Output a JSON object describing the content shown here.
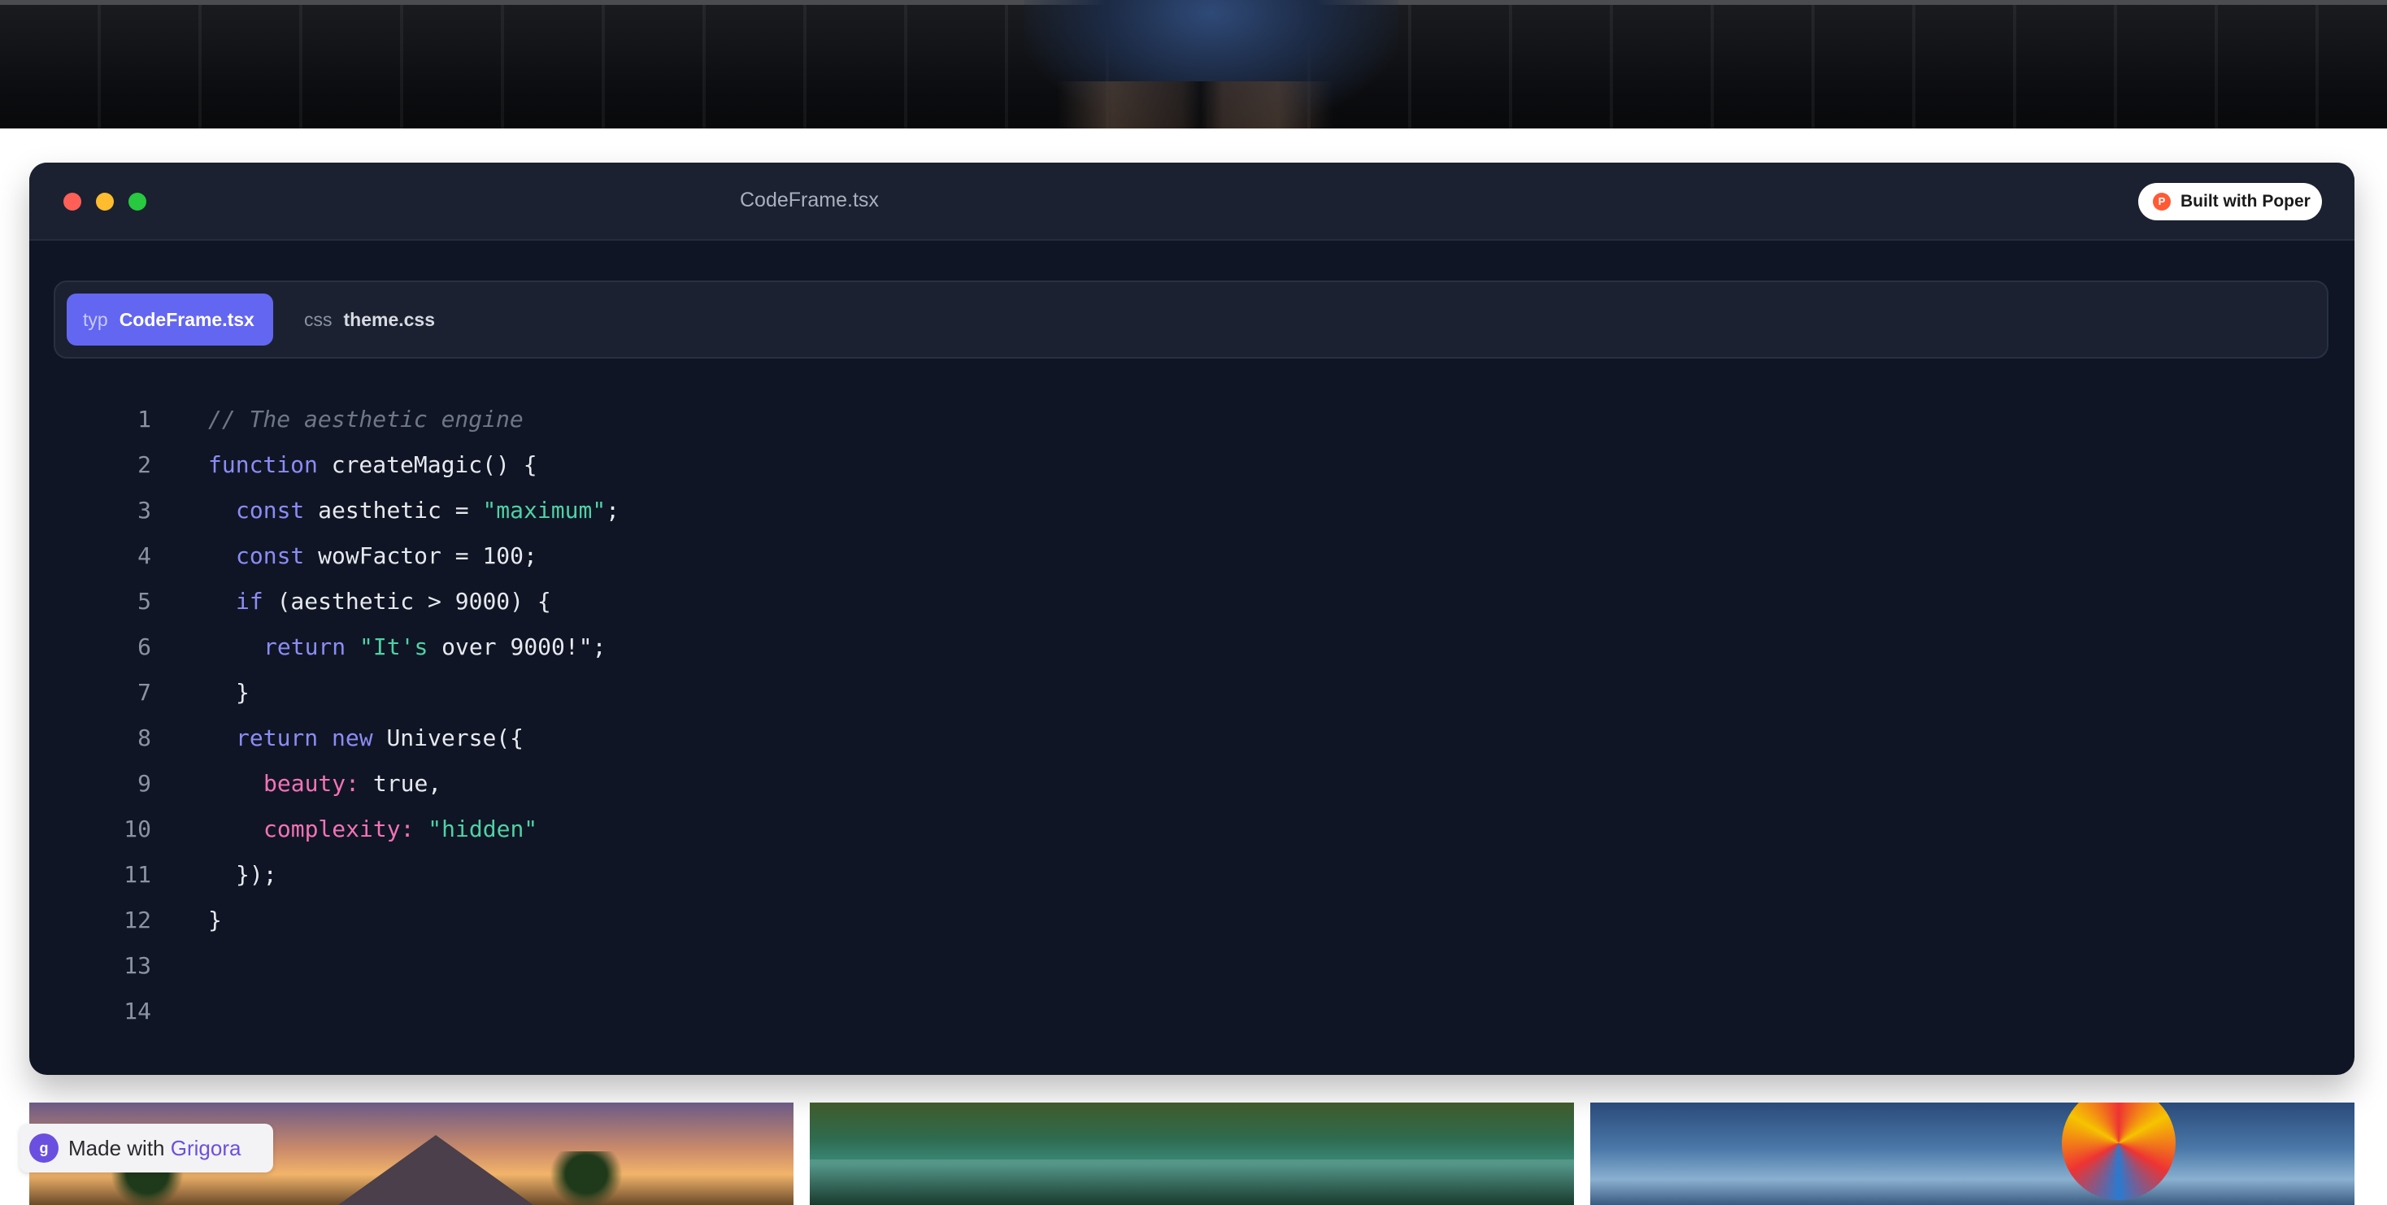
{
  "window": {
    "title": "CodeFrame.tsx",
    "badge_label": "Built with Poper",
    "badge_icon": "poper-logo-icon"
  },
  "tabs": [
    {
      "ext": "typ",
      "name": "CodeFrame.tsx",
      "active": true
    },
    {
      "ext": "css",
      "name": "theme.css",
      "active": false
    }
  ],
  "code_lines": [
    {
      "n": "1",
      "tokens": [
        {
          "t": "// The aesthetic engine",
          "k": "comment"
        }
      ],
      "indent": 0
    },
    {
      "n": "2",
      "tokens": [
        {
          "t": "function",
          "k": "kw"
        },
        {
          "t": " createMagic() {",
          "k": "plain"
        }
      ],
      "indent": 0
    },
    {
      "n": "3",
      "tokens": [
        {
          "t": "const",
          "k": "kw"
        },
        {
          "t": " aesthetic = ",
          "k": "plain"
        },
        {
          "t": "\"maximum\"",
          "k": "str"
        },
        {
          "t": ";",
          "k": "plain"
        }
      ],
      "indent": 1
    },
    {
      "n": "4",
      "tokens": [
        {
          "t": "const",
          "k": "kw"
        },
        {
          "t": " wowFactor = 100;",
          "k": "plain"
        }
      ],
      "indent": 1
    },
    {
      "n": "5",
      "tokens": [
        {
          "t": "if",
          "k": "kw"
        },
        {
          "t": " (aesthetic > 9000) {",
          "k": "plain"
        }
      ],
      "indent": 1
    },
    {
      "n": "6",
      "tokens": [
        {
          "t": "return",
          "k": "kw"
        },
        {
          "t": " ",
          "k": "plain"
        },
        {
          "t": "\"It's",
          "k": "str"
        },
        {
          "t": " over 9000!\";",
          "k": "plain"
        }
      ],
      "indent": 2
    },
    {
      "n": "7",
      "tokens": [
        {
          "t": "}",
          "k": "plain"
        }
      ],
      "indent": 1
    },
    {
      "n": "8",
      "tokens": [
        {
          "t": "return",
          "k": "kw"
        },
        {
          "t": " ",
          "k": "plain"
        },
        {
          "t": "new",
          "k": "kw"
        },
        {
          "t": " Universe({",
          "k": "plain"
        }
      ],
      "indent": 1
    },
    {
      "n": "9",
      "tokens": [
        {
          "t": "beauty:",
          "k": "prop"
        },
        {
          "t": " true,",
          "k": "plain"
        }
      ],
      "indent": 2
    },
    {
      "n": "10",
      "tokens": [
        {
          "t": "complexity:",
          "k": "prop"
        },
        {
          "t": " ",
          "k": "plain"
        },
        {
          "t": "\"hidden\"",
          "k": "str"
        }
      ],
      "indent": 2
    },
    {
      "n": "11",
      "tokens": [
        {
          "t": "});",
          "k": "plain"
        }
      ],
      "indent": 1
    },
    {
      "n": "12",
      "tokens": [
        {
          "t": "}",
          "k": "plain"
        }
      ],
      "indent": 0
    },
    {
      "n": "13",
      "tokens": [],
      "indent": 0
    },
    {
      "n": "14",
      "tokens": [],
      "indent": 0
    }
  ],
  "footer": {
    "made_with": "Made with",
    "brand": "Grigora",
    "icon": "grigora-logo-icon",
    "icon_glyph": "g"
  },
  "badge_glyph": "P",
  "colors": {
    "accent": "#6366f1",
    "keyword": "#8b8cf6",
    "string": "#4fd1a5",
    "property": "#f472b6",
    "comment": "#6f7787",
    "editor_bg": "#0f1524"
  }
}
